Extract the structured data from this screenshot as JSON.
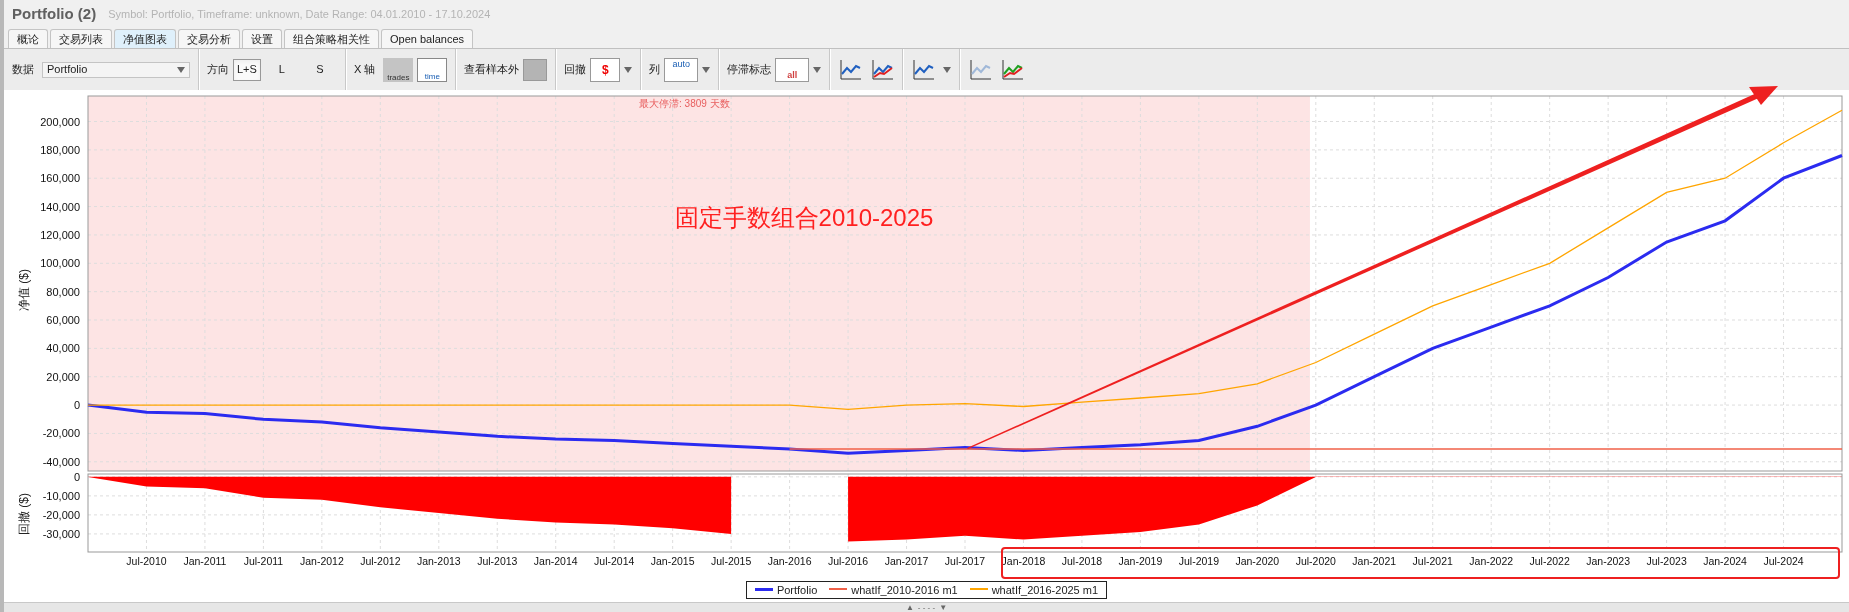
{
  "window": {
    "title": "Portfolio (2)",
    "subtitle": "Symbol: Portfolio, Timeframe: unknown, Date Range: 04.01.2010 - 17.10.2024"
  },
  "tabs": [
    {
      "label": "概论",
      "selected": false
    },
    {
      "label": "交易列表",
      "selected": false
    },
    {
      "label": "净值图表",
      "selected": true
    },
    {
      "label": "交易分析",
      "selected": false
    },
    {
      "label": "设置",
      "selected": false
    },
    {
      "label": "组合策略相关性",
      "selected": false
    },
    {
      "label": "Open balances",
      "selected": false
    }
  ],
  "toolbar": {
    "data_label": "数据",
    "data_value": "Portfolio",
    "direction_label": "方向",
    "directions": [
      {
        "label": "L+S",
        "selected": true
      },
      {
        "label": "L",
        "selected": false
      },
      {
        "label": "S",
        "selected": false
      }
    ],
    "xaxis_label": "X 轴",
    "xaxis_options": [
      {
        "label": "trades",
        "selected": false
      },
      {
        "label": "time",
        "selected": true
      }
    ],
    "out_of_sample_label": "查看样本外",
    "drawdown_label": "回撤",
    "drawdown_icon_text": "$",
    "columns_label": "列",
    "columns_icon_text": "auto",
    "stagnation_label": "停滞标志",
    "stagnation_icon_text": "all"
  },
  "equity_chart": {
    "chart_data": {
      "type": "line",
      "ylabel": "净值 ($)",
      "grid": true,
      "series": [
        {
          "name": "Portfolio",
          "color": "#2b2bf0",
          "values": [
            0,
            -5000,
            -6000,
            -10000,
            -12000,
            -16000,
            -19000,
            -22000,
            -24000,
            -25000,
            -27000,
            -29000,
            -31000,
            -34000,
            -32000,
            -30000,
            -32000,
            -30000,
            -28000,
            -25000,
            -15000,
            0,
            20000,
            40000,
            55000,
            70000,
            90000,
            115000,
            130000,
            160000,
            176000
          ]
        },
        {
          "name": "whatIf_2010-2016 m1",
          "color": "#f06048",
          "values": [
            null,
            null,
            null,
            null,
            null,
            null,
            null,
            null,
            null,
            null,
            null,
            null,
            -31000,
            -31000,
            -31000,
            -31000,
            -31000,
            -31000,
            -31000,
            -31000,
            -31000,
            -31000,
            -31000,
            -31000,
            -31000,
            -31000,
            -31000,
            -31000,
            -31000,
            -31000,
            -31000
          ]
        },
        {
          "name": "whatIf_2016-2025 m1",
          "color": "#ffa500",
          "values": [
            0,
            0,
            0,
            0,
            0,
            0,
            0,
            0,
            0,
            0,
            0,
            0,
            0,
            -3000,
            0,
            1000,
            -1000,
            2000,
            5000,
            8000,
            15000,
            30000,
            50000,
            70000,
            85000,
            100000,
            125000,
            150000,
            160000,
            185000,
            208000
          ]
        }
      ],
      "ylim": [
        -46500,
        218000
      ],
      "yticks": [
        {
          "value": 200000,
          "label": "200,000"
        },
        {
          "value": 180000,
          "label": "180,000"
        },
        {
          "value": 160000,
          "label": "160,000"
        },
        {
          "value": 140000,
          "label": "140,000"
        },
        {
          "value": 120000,
          "label": "120,000"
        },
        {
          "value": 100000,
          "label": "100,000"
        },
        {
          "value": 80000,
          "label": "80,000"
        },
        {
          "value": 60000,
          "label": "60,000"
        },
        {
          "value": 40000,
          "label": "40,000"
        },
        {
          "value": 20000,
          "label": "20,000"
        },
        {
          "value": 0,
          "label": "0"
        },
        {
          "value": -20000,
          "label": "-20,000"
        },
        {
          "value": -40000,
          "label": "-40,000"
        }
      ],
      "annotations": [
        {
          "text": "最大停滞: 3809 天数"
        },
        {
          "text": "固定手数组合2010-2025"
        }
      ]
    }
  },
  "drawdown_chart": {
    "chart_data": {
      "type": "area",
      "ylabel": "回撤 ($)",
      "grid": true,
      "categories": [
        null,
        "Jul-2010",
        "Jan-2011",
        "Jul-2011",
        "Jan-2012",
        "Jul-2012",
        "Jan-2013",
        "Jul-2013",
        "Jan-2014",
        "Jul-2014",
        "Jan-2015",
        "Jul-2015",
        "Jan-2016",
        "Jul-2016",
        "Jan-2017",
        "Jul-2017",
        "Jan-2018",
        "Jul-2018",
        "Jan-2019",
        "Jul-2019",
        "Jan-2020",
        "Jul-2020",
        "Jan-2021",
        "Jul-2021",
        "Jan-2022",
        "Jul-2022",
        "Jan-2023",
        "Jul-2023",
        "Jan-2024",
        "Jul-2024",
        null
      ],
      "series": [
        {
          "color": "#ff0000",
          "values": [
            0,
            -5000,
            -6000,
            -11000,
            -12000,
            -16000,
            -19000,
            -22000,
            -24000,
            -25000,
            -27000,
            -30000,
            null,
            -34000,
            -33000,
            -31000,
            -33000,
            -31000,
            -29000,
            -25000,
            -15000,
            0,
            0,
            0,
            0,
            0,
            0,
            0,
            0,
            0,
            0
          ]
        }
      ],
      "ylim": [
        -39500,
        1500
      ],
      "yticks": [
        {
          "value": 0,
          "label": "0"
        },
        {
          "value": -10000,
          "label": "-10,000"
        },
        {
          "value": -20000,
          "label": "-20,000"
        },
        {
          "value": -30000,
          "label": "-30,000"
        }
      ]
    }
  },
  "bottom_bar": {
    "up": "▲",
    "dots": "- - - -",
    "down": "▼"
  }
}
